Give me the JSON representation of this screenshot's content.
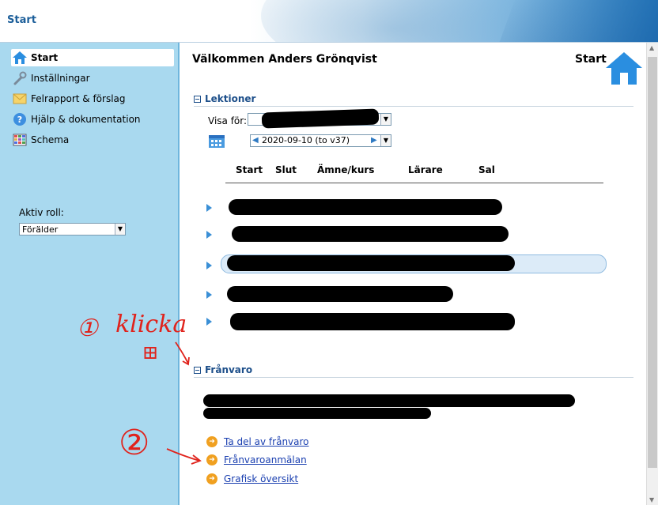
{
  "app": {
    "title": "Start"
  },
  "sidebar": {
    "items": [
      {
        "label": "Start",
        "icon": "home-icon",
        "active": true
      },
      {
        "label": "Inställningar",
        "icon": "wrench-icon"
      },
      {
        "label": "Felrapport & förslag",
        "icon": "envelope-icon"
      },
      {
        "label": "Hjälp & dokumentation",
        "icon": "help-icon"
      },
      {
        "label": "Schema",
        "icon": "calendar-grid-icon"
      }
    ],
    "role_label": "Aktiv roll:",
    "role_value": "Förälder"
  },
  "main": {
    "welcome": "Välkommen Anders Grönqvist",
    "page_label": "Start",
    "lektioner": {
      "title": "Lektioner",
      "visa_label": "Visa för:",
      "date_value": "2020-09-10 (to v37)",
      "columns": [
        "Start",
        "Slut",
        "Ämne/kurs",
        "Lärare",
        "Sal"
      ]
    },
    "franvaro": {
      "title": "Frånvaro",
      "links": [
        "Ta del av frånvaro",
        "Frånvaroanmälan",
        "Grafisk översikt"
      ]
    }
  },
  "annotations": {
    "step1_number": "①",
    "step1_text": "klicka",
    "step1_symbol": "⊞",
    "step2_number": "②"
  },
  "colors": {
    "sidebar_bg": "#a9d9ef",
    "section_title": "#1d4f8a",
    "link": "#1a3fb0",
    "annotation": "#e0231c"
  }
}
